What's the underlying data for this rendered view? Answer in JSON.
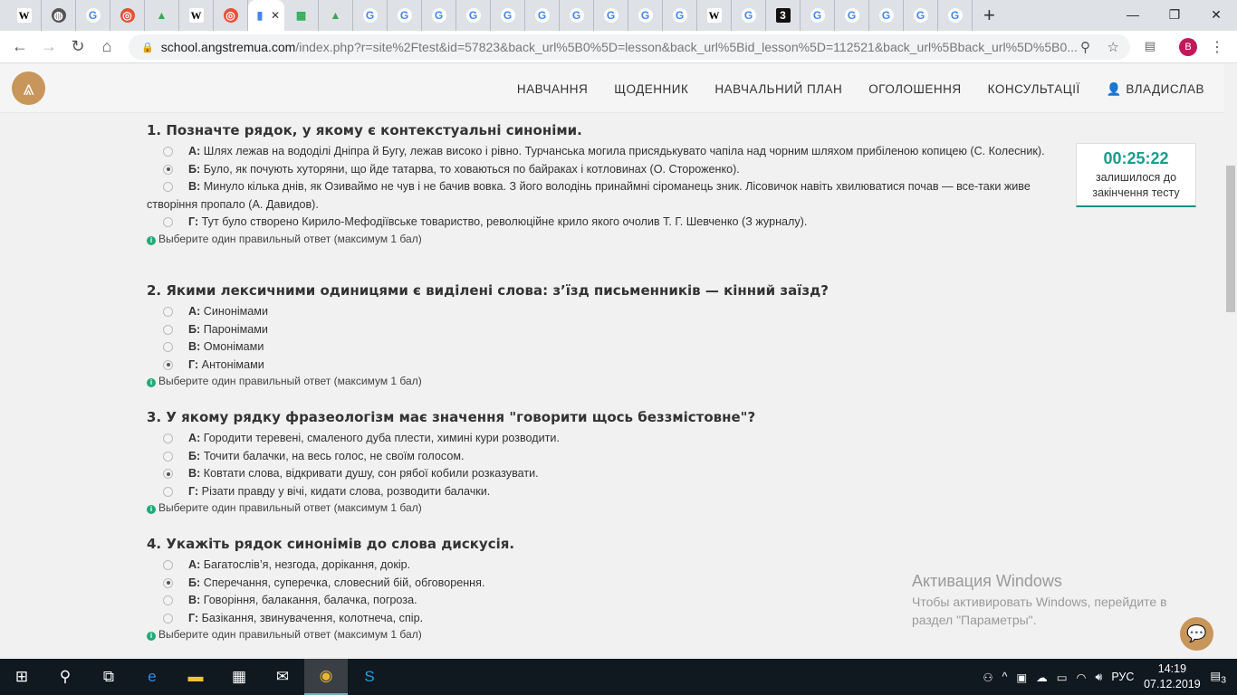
{
  "browser": {
    "tabs": [
      {
        "icon": "wikipedia-icon",
        "glyph": "W",
        "cls": "w"
      },
      {
        "icon": "globe-icon",
        "glyph": "◍",
        "cls": "glob"
      },
      {
        "icon": "google-icon",
        "glyph": "G",
        "cls": ""
      },
      {
        "icon": "target-icon",
        "glyph": "◎",
        "cls": "o"
      },
      {
        "icon": "drive-icon",
        "glyph": "▲",
        "cls": "d"
      },
      {
        "icon": "wikipedia-icon",
        "glyph": "W",
        "cls": "w"
      },
      {
        "icon": "target-icon",
        "glyph": "◎",
        "cls": "o"
      },
      {
        "icon": "page-icon",
        "glyph": "▮",
        "cls": "",
        "active": true
      },
      {
        "icon": "office-icon",
        "glyph": "▦",
        "cls": "d"
      },
      {
        "icon": "drive-icon",
        "glyph": "▲",
        "cls": "d"
      },
      {
        "icon": "google-icon",
        "glyph": "G",
        "cls": ""
      },
      {
        "icon": "google-icon",
        "glyph": "G",
        "cls": ""
      },
      {
        "icon": "google-icon",
        "glyph": "G",
        "cls": ""
      },
      {
        "icon": "google-icon",
        "glyph": "G",
        "cls": ""
      },
      {
        "icon": "google-icon",
        "glyph": "G",
        "cls": ""
      },
      {
        "icon": "google-icon",
        "glyph": "G",
        "cls": ""
      },
      {
        "icon": "google-icon",
        "glyph": "G",
        "cls": ""
      },
      {
        "icon": "google-icon",
        "glyph": "G",
        "cls": ""
      },
      {
        "icon": "google-icon",
        "glyph": "G",
        "cls": ""
      },
      {
        "icon": "google-icon",
        "glyph": "G",
        "cls": ""
      },
      {
        "icon": "wikipedia-icon",
        "glyph": "W",
        "cls": "w"
      },
      {
        "icon": "google-icon",
        "glyph": "G",
        "cls": ""
      },
      {
        "icon": "three-icon",
        "glyph": "3",
        "cls": "b"
      },
      {
        "icon": "google-icon",
        "glyph": "G",
        "cls": ""
      },
      {
        "icon": "google-icon",
        "glyph": "G",
        "cls": ""
      },
      {
        "icon": "google-icon",
        "glyph": "G",
        "cls": ""
      },
      {
        "icon": "google-icon",
        "glyph": "G",
        "cls": ""
      },
      {
        "icon": "google-icon",
        "glyph": "G",
        "cls": ""
      }
    ],
    "url_host": "school.angstremua.com",
    "url_path": "/index.php?r=site%2Ftest&id=57823&back_url%5B0%5D=lesson&back_url%5Bid_lesson%5D=112521&back_url%5Bback_url%5D%5B0...",
    "profile_initial": "B"
  },
  "nav": [
    "НАВЧАННЯ",
    "ЩОДЕННИК",
    "НАВЧАЛЬНИЙ ПЛАН",
    "ОГОЛОШЕННЯ",
    "КОНСУЛЬТАЦІЇ",
    "ВЛАДИСЛАВ"
  ],
  "timer": {
    "time": "00:25:22",
    "label": "залишилося до закінчення тесту"
  },
  "hint": "Выберите один правильный ответ (максимум 1 бал)",
  "questions": [
    {
      "title": "1. Позначте рядок, у якому є контекстуальні синоніми.",
      "selected": 1,
      "options": [
        {
          "letter": "А:",
          "text": " Шлях лежав на вододілі Дніпра й Бугу, лежав високо і рівно. Турчанська могила присядькувато чапіла над чорним шляхом прибіленою копицею (С. Колесник)."
        },
        {
          "letter": "Б:",
          "text": " Було, як почують хуторяни, що йде татарва, то ховаються по байраках і котловинах (О. Стороженко)."
        },
        {
          "letter": "В:",
          "text": " Минуло кілька днів, як Озиваймо не чув і не бачив вовка. З його володінь принаймні сіроманець зник. Лісовичок навіть хвилюватися почав — все-таки живе створіння пропало (А. Давидов)."
        },
        {
          "letter": "Г:",
          "text": " Тут було створено Кирило-Мефодіївське товариство, революційне крило якого очолив Т. Г. Шевченко (З журналу)."
        }
      ]
    },
    {
      "title": "2. Якими лексичними одиницями є виділені слова: з’їзд письменників — кінний заїзд?",
      "selected": 3,
      "options": [
        {
          "letter": "А:",
          "text": " Синонімами"
        },
        {
          "letter": "Б:",
          "text": " Паронімами"
        },
        {
          "letter": "В:",
          "text": " Омонімами"
        },
        {
          "letter": "Г:",
          "text": " Антонімами"
        }
      ]
    },
    {
      "title": "3. У якому рядку фразеологізм має значення \"говорити щось беззмістовне\"?",
      "selected": 2,
      "options": [
        {
          "letter": "А:",
          "text": " Городити теревені, смаленого дуба плести, химині кури розводити."
        },
        {
          "letter": "Б:",
          "text": " Точити балачки, на весь голос, не своїм голосом."
        },
        {
          "letter": "В:",
          "text": " Ковтати слова, відкривати душу, сон рябої кобили розказувати."
        },
        {
          "letter": "Г:",
          "text": " Різати правду у вічі, кидати слова, розводити балачки."
        }
      ]
    },
    {
      "title": "4. Укажіть рядок синонімів до слова дискусія.",
      "selected": 1,
      "options": [
        {
          "letter": "А:",
          "text": " Багатослів’я, незгода, дорікання, докір."
        },
        {
          "letter": "Б:",
          "text": " Сперечання, суперечка, словесний бій, обговорення."
        },
        {
          "letter": "В:",
          "text": " Говоріння, балакання, балачка, погроза."
        },
        {
          "letter": "Г:",
          "text": " Базікання, звинувачення, колотнеча, спір."
        }
      ]
    }
  ],
  "activation": {
    "title": "Активация Windows",
    "line1": "Чтобы активировать Windows, перейдите в",
    "line2": "раздел \"Параметры\"."
  },
  "taskbar": {
    "lang": "РУС",
    "time": "14:19",
    "date": "07.12.2019",
    "notifications": "3"
  }
}
